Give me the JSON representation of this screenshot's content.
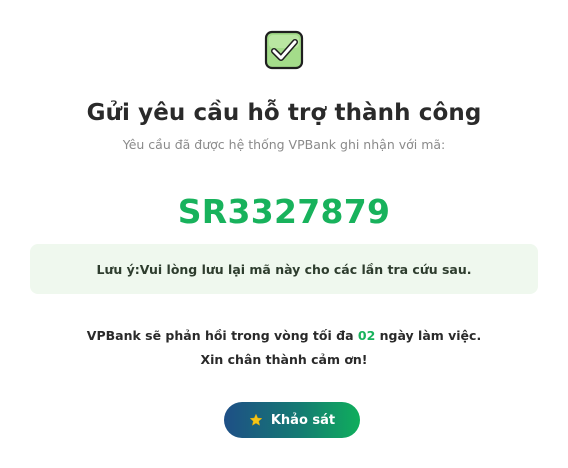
{
  "success": {
    "icon": "checkbox-check-icon",
    "title": "Gửi yêu cầu hỗ trợ thành công",
    "subtitle": "Yêu cầu đã được hệ thống VPBank ghi nhận với mã:",
    "request_code": "SR3327879"
  },
  "note": {
    "label": "Lưu ý:",
    "text": " Vui lòng lưu lại mã này cho các lần tra cứu sau."
  },
  "response": {
    "prefix": "VPBank sẽ phản hồi trong vòng tối đa ",
    "days": "02",
    "suffix": " ngày làm việc.",
    "thanks": "Xin chân thành cảm ơn!"
  },
  "survey_button": {
    "icon": "star-icon",
    "label": "Khảo sát"
  },
  "colors": {
    "accent_green": "#18b25c",
    "note_background": "#eff8ee",
    "button_gradient_start": "#1e4f86",
    "button_gradient_end": "#0fae5c",
    "star": "#f5c518"
  }
}
